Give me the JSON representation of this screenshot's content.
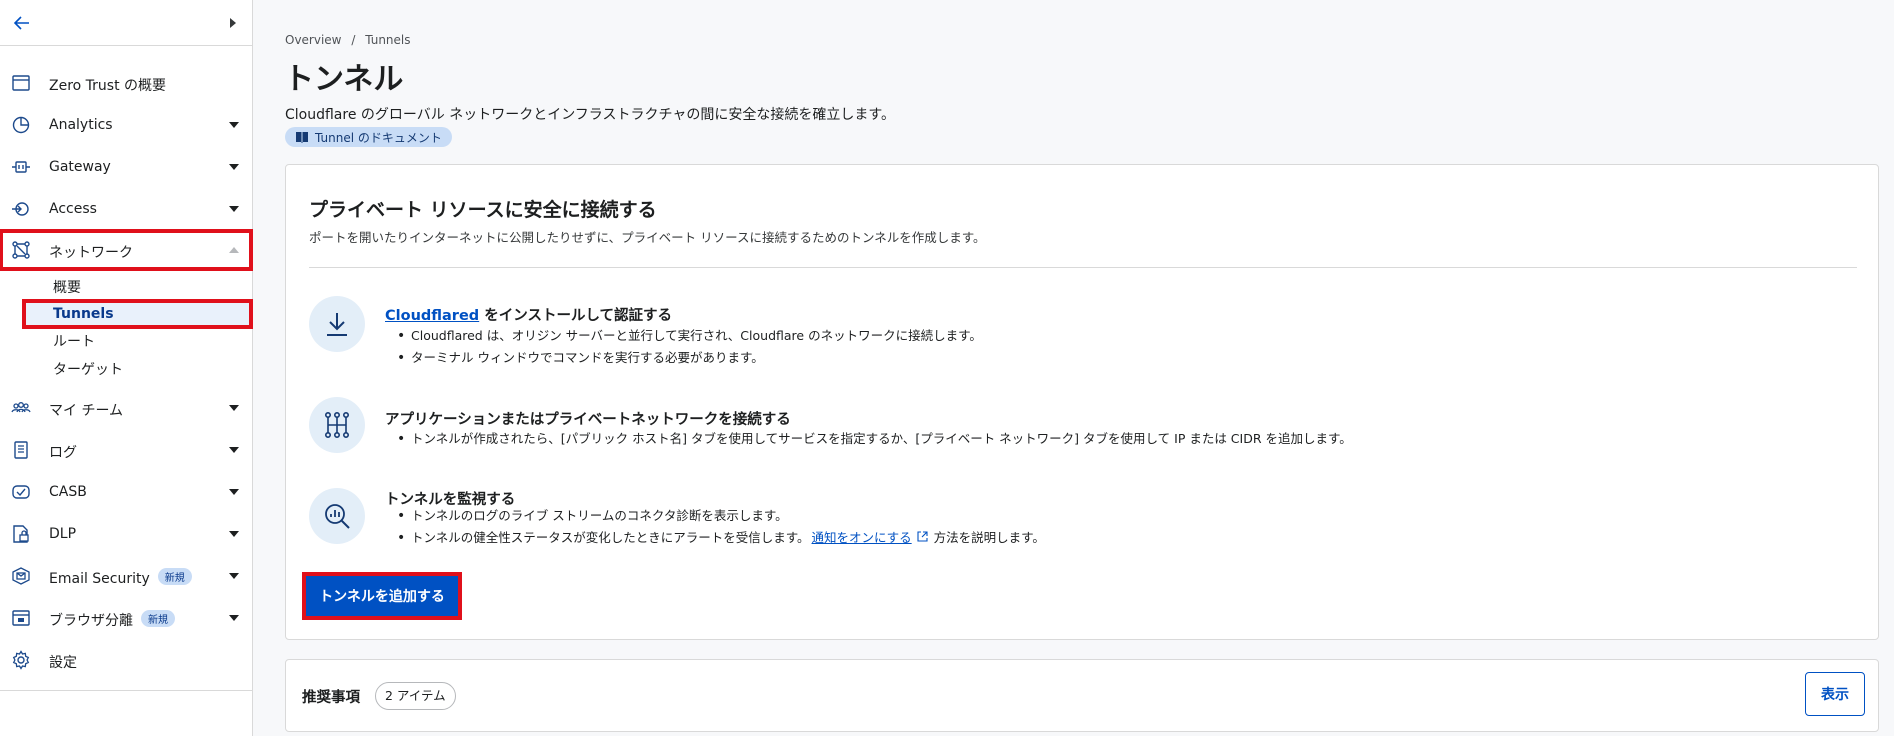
{
  "sidebar": {
    "items": [
      {
        "label": "Zero Trust の概要"
      },
      {
        "label": "Analytics"
      },
      {
        "label": "Gateway"
      },
      {
        "label": "Access"
      },
      {
        "label": "ネットワーク"
      },
      {
        "label": "マイ チーム"
      },
      {
        "label": "ログ"
      },
      {
        "label": "CASB"
      },
      {
        "label": "DLP"
      },
      {
        "label": "Email Security",
        "badge": "新規"
      },
      {
        "label": "ブラウザ分離",
        "badge": "新規"
      },
      {
        "label": "設定"
      }
    ],
    "network_sub": [
      {
        "label": "概要"
      },
      {
        "label": "Tunnels"
      },
      {
        "label": "ルート"
      },
      {
        "label": "ターゲット"
      }
    ]
  },
  "breadcrumb": {
    "overview": "Overview",
    "sep": "/",
    "current": "Tunnels"
  },
  "page": {
    "title": "トンネル",
    "description": "Cloudflare のグローバル ネットワークとインフラストラクチャの間に安全な接続を確立します。",
    "doc_badge": "Tunnel のドキュメント"
  },
  "card": {
    "title": "プライベート リソースに安全に接続する",
    "subtitle": "ポートを開いたりインターネットに公開したりせずに、プライベート リソースに接続するためのトンネルを作成します。",
    "steps": [
      {
        "title_link": "Cloudflared",
        "title_rest": " をインストールして認証する",
        "bullets": [
          "Cloudflared は、オリジン サーバーと並行して実行され、Cloudflare のネットワークに接続します。",
          "ターミナル ウィンドウでコマンドを実行する必要があります。"
        ]
      },
      {
        "title": "アプリケーションまたはプライベートネットワークを接続する",
        "bullets": [
          "トンネルが作成されたら、[パブリック ホスト名] タブを使用してサービスを指定するか、[プライベート ネットワーク] タブを使用して IP または CIDR を追加します。"
        ]
      },
      {
        "title": "トンネルを監視する",
        "bullets": [
          "トンネルのログのライブ ストリームのコネクタ診断を表示します。"
        ],
        "bullet2_pre": "トンネルの健全性ステータスが変化したときにアラートを受信します。",
        "bullet2_link": "通知をオンにする",
        "bullet2_post": " 方法を説明します。"
      }
    ],
    "add_button": "トンネルを追加する"
  },
  "recommendations": {
    "label": "推奨事項",
    "count": "2 アイテム",
    "show_button": "表示"
  },
  "colors": {
    "accent": "#0051c3",
    "highlight": "#e0101b",
    "badge_bg": "#c8dcf6"
  }
}
